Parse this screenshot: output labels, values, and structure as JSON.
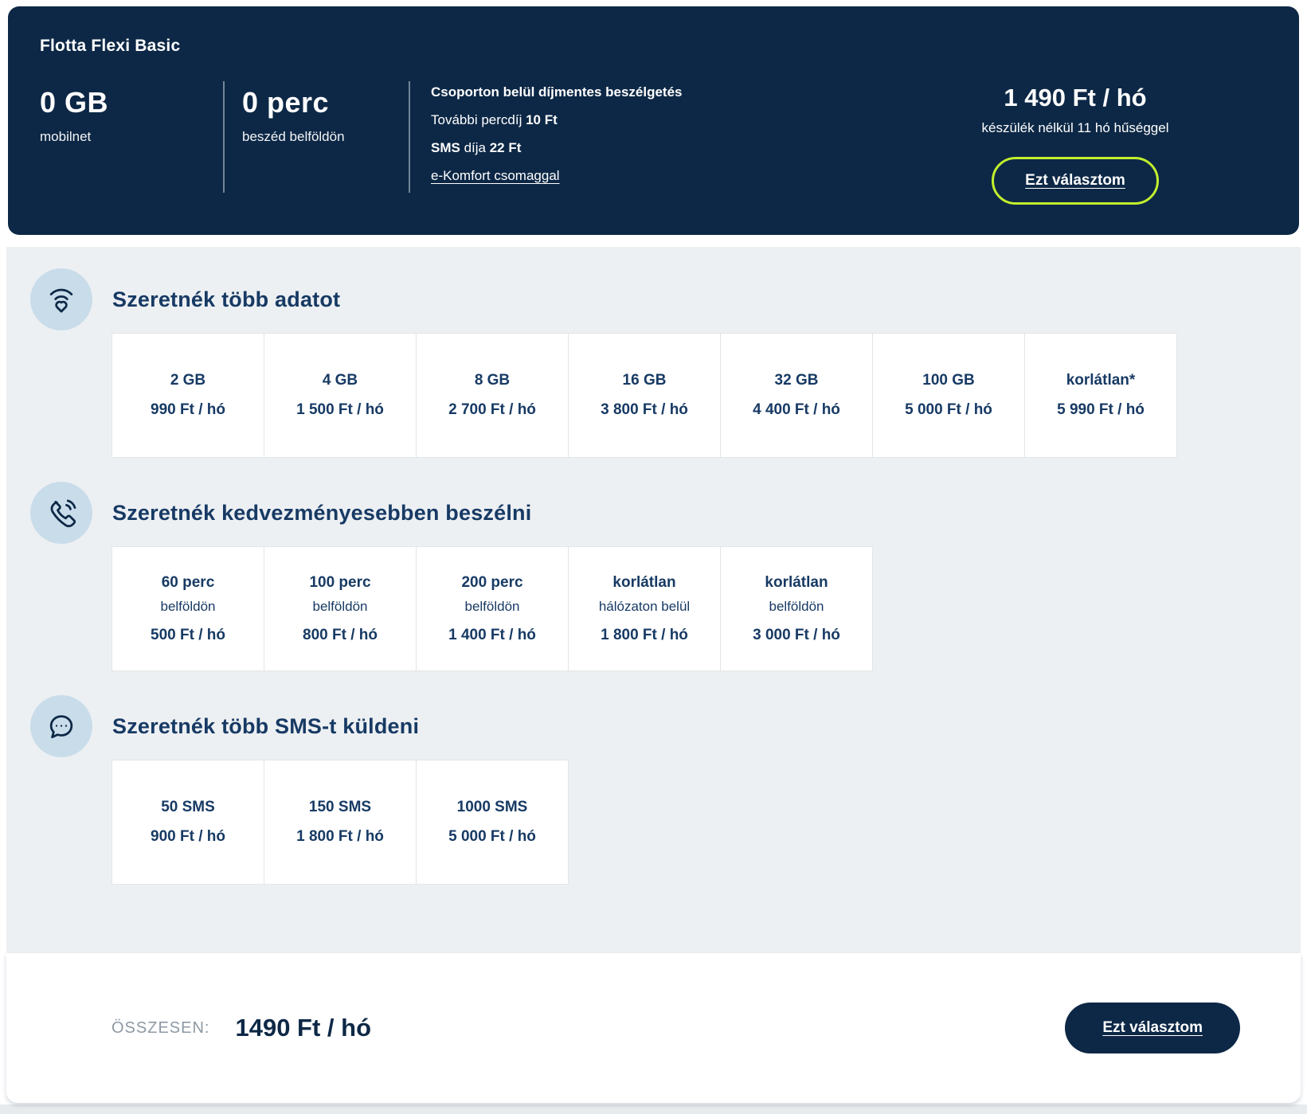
{
  "header": {
    "plan_name": "Flotta Flexi Basic",
    "data_allowance": {
      "value": "0 GB",
      "label": "mobilnet"
    },
    "minutes_allowance": {
      "value": "0 perc",
      "label": "beszéd belföldön"
    },
    "detail_lines": [
      [
        {
          "t": "Csoporton belül díjmentes beszélgetés",
          "b": true
        }
      ],
      [
        {
          "t": "További percdíj ",
          "b": false
        },
        {
          "t": "10 Ft",
          "b": true
        }
      ],
      [
        {
          "t": "SMS",
          "b": true
        },
        {
          "t": " díja ",
          "b": false
        },
        {
          "t": "22 Ft",
          "b": true
        }
      ]
    ],
    "detail_link": "e-Komfort csomaggal",
    "price": "1 490 Ft / hó",
    "price_note": "készülék nélkül 11 hó hűséggel",
    "cta_label": "Ezt választom"
  },
  "sections": [
    {
      "icon": "wifi-heart-icon",
      "title": "Szeretnék több adatot",
      "options": [
        {
          "title": "2 GB",
          "price": "990 Ft / hó"
        },
        {
          "title": "4 GB",
          "price": "1 500 Ft / hó"
        },
        {
          "title": "8 GB",
          "price": "2 700 Ft / hó"
        },
        {
          "title": "16 GB",
          "price": "3 800 Ft / hó"
        },
        {
          "title": "32 GB",
          "price": "4 400 Ft / hó"
        },
        {
          "title": "100 GB",
          "price": "5 000 Ft / hó"
        },
        {
          "title": "korlátlan*",
          "price": "5 990 Ft / hó"
        }
      ]
    },
    {
      "icon": "phone-icon",
      "title": "Szeretnék kedvezményesebben beszélni",
      "options": [
        {
          "title": "60 perc",
          "subtitle": "belföldön",
          "price": "500 Ft / hó"
        },
        {
          "title": "100 perc",
          "subtitle": "belföldön",
          "price": "800 Ft / hó"
        },
        {
          "title": "200 perc",
          "subtitle": "belföldön",
          "price": "1 400 Ft / hó"
        },
        {
          "title": "korlátlan",
          "subtitle": "hálózaton belül",
          "price": "1 800 Ft / hó"
        },
        {
          "title": "korlátlan",
          "subtitle": "belföldön",
          "price": "3 000 Ft / hó"
        }
      ]
    },
    {
      "icon": "chat-bubble-icon",
      "title": "Szeretnék több SMS-t küldeni",
      "options": [
        {
          "title": "50 SMS",
          "price": "900 Ft / hó"
        },
        {
          "title": "150 SMS",
          "price": "1 800 Ft / hó"
        },
        {
          "title": "1000 SMS",
          "price": "5 000 Ft / hó"
        }
      ]
    }
  ],
  "footer": {
    "total_label": "ÖSSZESEN:",
    "total_value": "1490 Ft / hó",
    "cta_label": "Ezt választom"
  },
  "colors": {
    "navy": "#0d2846",
    "navy_text": "#173a64",
    "accent_green": "#c1f02d",
    "icon_circle_blue": "#c9dcea",
    "panel_gray": "#edf0f3",
    "muted_gray": "#8d99a4"
  }
}
